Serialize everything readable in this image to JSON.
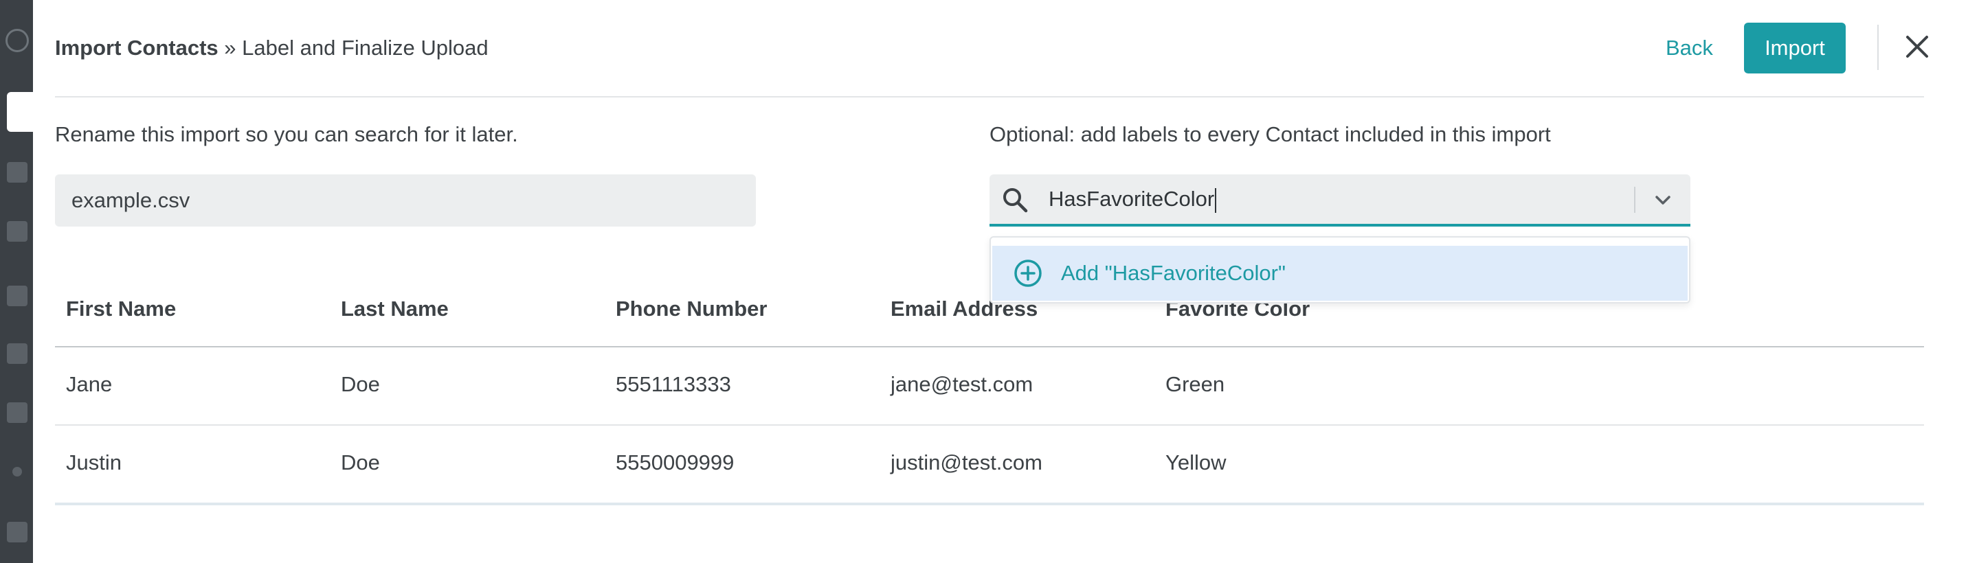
{
  "header": {
    "title_bold": "Import Contacts",
    "title_rest": " » Label and Finalize Upload",
    "back_label": "Back",
    "import_label": "Import"
  },
  "rename": {
    "label": "Rename this import so you can search for it later.",
    "value": "example.csv"
  },
  "labels": {
    "label": "Optional: add labels to every Contact included in this import",
    "search_value": "HasFavoriteColor",
    "dropdown_option": "Add \"HasFavoriteColor\""
  },
  "table": {
    "headers": [
      "First Name",
      "Last Name",
      "Phone Number",
      "Email Address",
      "Favorite Color"
    ],
    "rows": [
      [
        "Jane",
        "Doe",
        "5551113333",
        "jane@test.com",
        "Green"
      ],
      [
        "Justin",
        "Doe",
        "5550009999",
        "justin@test.com",
        "Yellow"
      ]
    ]
  },
  "colors": {
    "accent": "#1b9ca5",
    "highlight": "#deebfa",
    "text": "#3d4246"
  },
  "icons": [
    "search-icon",
    "chevron-down-icon",
    "plus-circle-icon",
    "close-icon"
  ]
}
